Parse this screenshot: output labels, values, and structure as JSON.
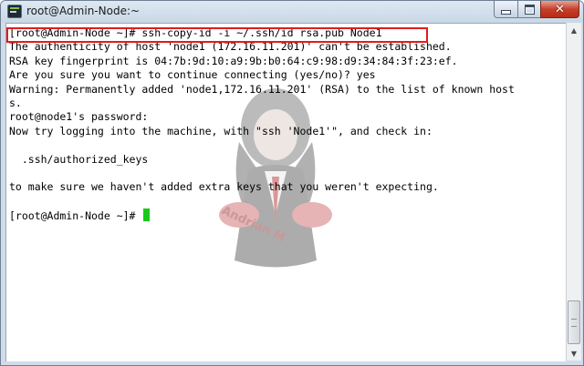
{
  "window": {
    "title": "root@Admin-Node:~",
    "icon": "terminal-icon",
    "controls": {
      "minimize": "minimize-icon",
      "maximize": "maximize-icon",
      "close": "✕"
    }
  },
  "terminal": {
    "lines": [
      "[root@Admin-Node ~]# ssh-copy-id -i ~/.ssh/id rsa.pub Node1",
      "The authenticity of host 'node1 (172.16.11.201)' can't be established.",
      "RSA key fingerprint is 04:7b:9d:10:a9:9b:b0:64:c9:98:d9:34:84:3f:23:ef.",
      "Are you sure you want to continue connecting (yes/no)? yes",
      "Warning: Permanently added 'node1,172.16.11.201' (RSA) to the list of known host",
      "s.",
      "root@node1's password:",
      "Now try logging into the machine, with \"ssh 'Node1'\", and check in:",
      "",
      "  .ssh/authorized_keys",
      "",
      "to make sure we haven't added extra keys that you weren't expecting.",
      "",
      "[root@Admin-Node ~]# "
    ],
    "highlighted_line_index": 0,
    "highlight_color": "#e31b1b",
    "cursor_color": "#19c919",
    "watermark_text": "Andrian M"
  },
  "scrollbar": {
    "up": "scroll-up-arrow-icon",
    "down": "scroll-down-arrow-icon"
  }
}
